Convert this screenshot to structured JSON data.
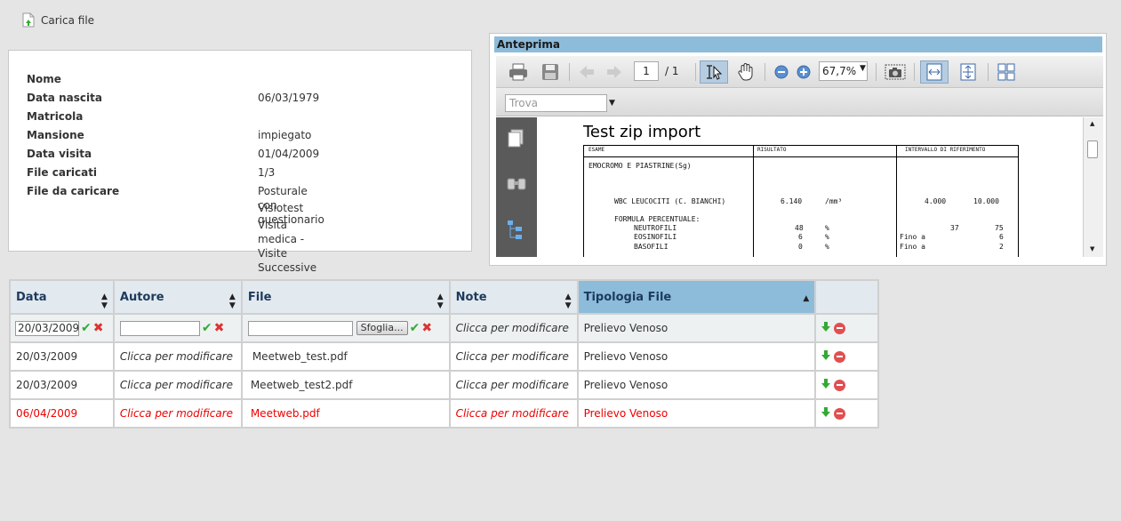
{
  "upload": {
    "label": "Carica file"
  },
  "info": {
    "rows": [
      {
        "label": "Nome",
        "value": ""
      },
      {
        "label": "Data nascita",
        "value": "06/03/1979"
      },
      {
        "label": "Matricola",
        "value": ""
      },
      {
        "label": "Mansione",
        "value": "impiegato"
      },
      {
        "label": "Data visita",
        "value": "01/04/2009"
      },
      {
        "label": "File caricati",
        "value": "1/3"
      },
      {
        "label": "File da caricare",
        "value": "Posturale con questionario"
      },
      {
        "label": "",
        "value": "Visiotest"
      },
      {
        "label": "",
        "value": "Visita medica - Visite Successive"
      }
    ]
  },
  "preview": {
    "title": "Anteprima",
    "page_current": "1",
    "page_total": "/ 1",
    "zoom": "67,7%",
    "find_placeholder": "Trova",
    "doc": {
      "title": "Test zip import",
      "col_esame": "ESAME",
      "col_risultato": "RISULTATO",
      "col_intervallo": "INTERVALLO DI RIFERIMENTO",
      "section": "EMOCROMO E PIASTRINE(Sg)",
      "wbc": "WBC LEUCOCITI (C. BIANCHI)",
      "wbc_val": "6.140",
      "wbc_unit": "/mm³",
      "wbc_min": "4.000",
      "wbc_max": "10.000",
      "formula": "FORMULA PERCENTUALE:",
      "rows": [
        {
          "name": "NEUTROFILI",
          "val": "48",
          "unit": "%",
          "pre": "",
          "min": "37",
          "max": "75"
        },
        {
          "name": "EOSINOFILI",
          "val": "6",
          "unit": "%",
          "pre": "Fino a",
          "min": "",
          "max": "6"
        },
        {
          "name": "BASOFILI",
          "val": "0",
          "unit": "%",
          "pre": "Fino a",
          "min": "",
          "max": "2"
        }
      ]
    }
  },
  "grid": {
    "headers": [
      "Data",
      "Autore",
      "File",
      "Note",
      "Tipologia File"
    ],
    "edit_row": {
      "date": "20/03/2009",
      "browse": "Sfoglia...",
      "note": "Clicca per modificare",
      "type": "Prelievo Venoso"
    },
    "rows": [
      {
        "date": "20/03/2009",
        "author": "Clicca per modificare",
        "file": "Meetweb_test.pdf",
        "note": "Clicca per modificare",
        "type": "Prelievo Venoso"
      },
      {
        "date": "20/03/2009",
        "author": "Clicca per modificare",
        "file": "Meetweb_test2.pdf",
        "note": "Clicca per modificare",
        "type": "Prelievo Venoso"
      },
      {
        "date": "06/04/2009",
        "author": "Clicca per modificare",
        "file": "Meetweb.pdf",
        "note": "Clicca per modificare",
        "type": "Prelievo Venoso"
      }
    ]
  },
  "colors": {
    "accent": "#8dbcdb",
    "header_bg": "#e2e9ef",
    "error_red": "#e00000"
  }
}
